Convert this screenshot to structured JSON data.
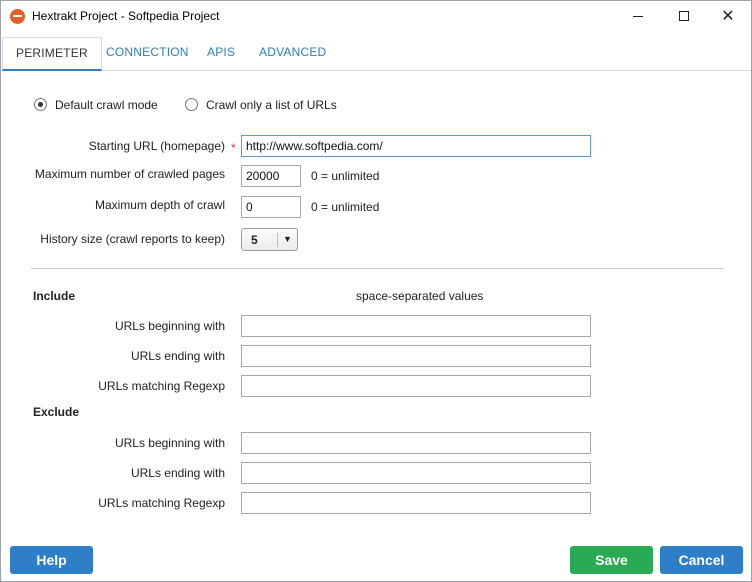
{
  "window": {
    "title": "Hextrakt Project - Softpedia Project"
  },
  "tabs": [
    {
      "label": "PERIMETER"
    },
    {
      "label": "CONNECTION"
    },
    {
      "label": "APIS"
    },
    {
      "label": "ADVANCED"
    }
  ],
  "crawl_mode": {
    "option1": "Default crawl mode",
    "option2": "Crawl only a list of URLs",
    "selected": "Default crawl mode"
  },
  "settings": {
    "starting_url_label": "Starting URL (homepage)",
    "starting_url_value": "http://www.softpedia.com/",
    "required_mark": "*",
    "max_pages_label": "Maximum number of crawled pages",
    "max_pages_value": "20000",
    "max_pages_hint": "0 = unlimited",
    "max_depth_label": "Maximum depth of crawl",
    "max_depth_value": "0",
    "max_depth_hint": "0 = unlimited",
    "history_label": "History size (crawl reports to keep)",
    "history_value": "5"
  },
  "include": {
    "title": "Include",
    "hint": "space-separated values",
    "beginning_label": "URLs beginning with",
    "ending_label": "URLs ending with",
    "regexp_label": "URLs matching Regexp"
  },
  "exclude": {
    "title": "Exclude",
    "beginning_label": "URLs beginning with",
    "ending_label": "URLs ending with",
    "regexp_label": "URLs matching Regexp"
  },
  "buttons": {
    "help": "Help",
    "save": "Save",
    "cancel": "Cancel"
  },
  "colors": {
    "accent_blue": "#2f7fc8",
    "save_green": "#2aaa53",
    "tab_link": "#2f7ec0"
  }
}
